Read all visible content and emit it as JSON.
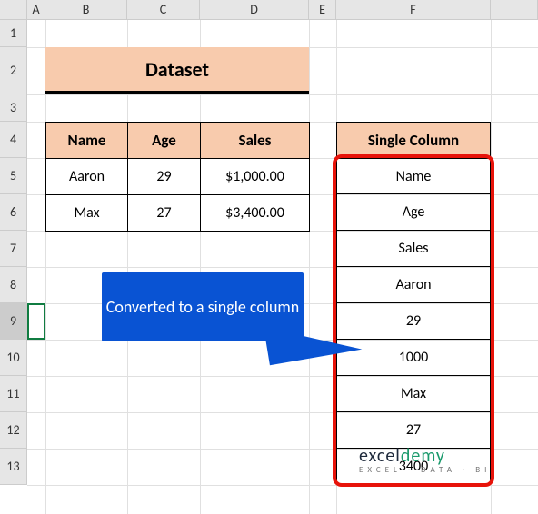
{
  "columns": {
    "A": "A",
    "B": "B",
    "C": "C",
    "D": "D",
    "E": "E",
    "F": "F",
    "G": ""
  },
  "rows": {
    "1": "1",
    "2": "2",
    "3": "3",
    "4": "4",
    "5": "5",
    "6": "6",
    "7": "7",
    "8": "8",
    "9": "9",
    "10": "10",
    "11": "11",
    "12": "12",
    "13": "13"
  },
  "title": "Dataset",
  "table_headers": {
    "name": "Name",
    "age": "Age",
    "sales": "Sales"
  },
  "table_rows": [
    {
      "name": "Aaron",
      "age": "29",
      "sales": "$1,000.00"
    },
    {
      "name": "Max",
      "age": "27",
      "sales": "$3,400.00"
    }
  ],
  "single_header": "Single Column",
  "single_values": [
    "Name",
    "Age",
    "Sales",
    "Aaron",
    "29",
    "1000",
    "Max",
    "27",
    "3400"
  ],
  "callout": "Converted to a single column",
  "brand_left": "excel",
  "brand_right": "demy",
  "brand_tag": "EXCEL · DATA · BI",
  "chart_data": {
    "type": "table",
    "title": "Dataset",
    "source_table": {
      "columns": [
        "Name",
        "Age",
        "Sales"
      ],
      "rows": [
        [
          "Aaron",
          29,
          1000.0
        ],
        [
          "Max",
          27,
          3400.0
        ]
      ]
    },
    "single_column": [
      "Name",
      "Age",
      "Sales",
      "Aaron",
      29,
      1000,
      "Max",
      27,
      3400
    ]
  }
}
